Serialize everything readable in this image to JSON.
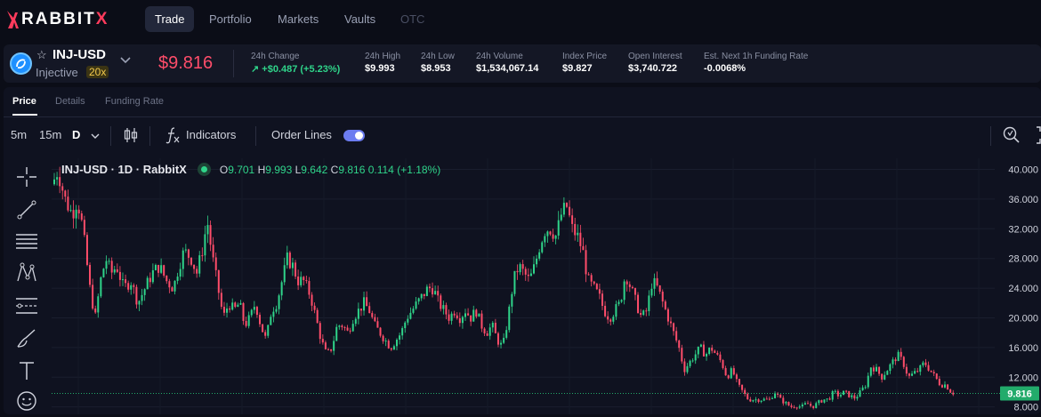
{
  "nav": {
    "logo_main": "RABBIT",
    "logo_x": "X",
    "tabs": [
      "Trade",
      "Portfolio",
      "Markets",
      "Vaults",
      "OTC"
    ]
  },
  "market": {
    "pair": "INJ-USD",
    "name": "Injective",
    "leverage": "20x",
    "price": "$9.816",
    "stats": [
      {
        "label": "24h Change",
        "value": "↗ +$0.487 (+5.23%)",
        "tone": "green"
      },
      {
        "label": "24h High",
        "value": "$9.993",
        "tone": "white"
      },
      {
        "label": "24h Low",
        "value": "$8.953",
        "tone": "white"
      },
      {
        "label": "24h Volume",
        "value": "$1,534,067.14",
        "tone": "white"
      },
      {
        "label": "Index Price",
        "value": "$9.827",
        "tone": "white"
      },
      {
        "label": "Open Interest",
        "value": "$3,740.722",
        "tone": "white"
      },
      {
        "label": "Est. Next 1h Funding Rate",
        "value": "-0.0068%",
        "tone": "white"
      }
    ]
  },
  "panel_tabs": [
    "Price",
    "Details",
    "Funding Rate"
  ],
  "toolbar": {
    "intervals": [
      "5m",
      "15m",
      "D"
    ],
    "indicators": "Indicators",
    "order_lines": "Order Lines",
    "order_lines_on": true
  },
  "legend": {
    "title": "INJ-USD · 1D · RabbitX",
    "o_key": "O",
    "o_val": "9.701",
    "h_key": "H",
    "h_val": "9.993",
    "l_key": "L",
    "l_val": "9.642",
    "c_key": "C",
    "c_val": "9.816",
    "change": "0.114 (+1.18%)"
  },
  "draw_tools": [
    "crosshair-icon",
    "trendline-icon",
    "fib-icon",
    "pattern-icon",
    "prediction-icon",
    "brush-icon",
    "text-icon",
    "emoji-icon"
  ],
  "colors": {
    "up": "#2fd48a",
    "down": "#ff4d6a",
    "price_tag": "#22ab6b"
  },
  "chart_data": {
    "type": "candlestick",
    "title": "INJ-USD · 1D · RabbitX",
    "ylim": [
      7,
      41.5
    ],
    "y_ticks": [
      "40.000",
      "36.000",
      "32.000",
      "28.000",
      "24.000",
      "20.000",
      "16.000",
      "12.000",
      "8.000"
    ],
    "y_tick_values": [
      40,
      36,
      32,
      28,
      24,
      20,
      16,
      12,
      8
    ],
    "last_price": 9.816,
    "last_price_label": "9.816",
    "close_path": [
      [
        0,
        38
      ],
      [
        6,
        40
      ],
      [
        14,
        36
      ],
      [
        22,
        34
      ],
      [
        28,
        36
      ],
      [
        34,
        32
      ],
      [
        42,
        24
      ],
      [
        48,
        20
      ],
      [
        54,
        25
      ],
      [
        60,
        28
      ],
      [
        66,
        26
      ],
      [
        72,
        27
      ],
      [
        80,
        24
      ],
      [
        88,
        25
      ],
      [
        96,
        22
      ],
      [
        104,
        24
      ],
      [
        112,
        26
      ],
      [
        120,
        27
      ],
      [
        128,
        25
      ],
      [
        136,
        24
      ],
      [
        142,
        27
      ],
      [
        148,
        29
      ],
      [
        156,
        28
      ],
      [
        162,
        26
      ],
      [
        168,
        29
      ],
      [
        174,
        33
      ],
      [
        180,
        28
      ],
      [
        186,
        24
      ],
      [
        192,
        20
      ],
      [
        198,
        22
      ],
      [
        204,
        21
      ],
      [
        210,
        22
      ],
      [
        216,
        19
      ],
      [
        222,
        20
      ],
      [
        228,
        22
      ],
      [
        234,
        19
      ],
      [
        240,
        17
      ],
      [
        246,
        21
      ],
      [
        252,
        22
      ],
      [
        258,
        25
      ],
      [
        264,
        28
      ],
      [
        270,
        27
      ],
      [
        276,
        25
      ],
      [
        282,
        25
      ],
      [
        290,
        23
      ],
      [
        296,
        20
      ],
      [
        302,
        17
      ],
      [
        308,
        15
      ],
      [
        314,
        16
      ],
      [
        320,
        19
      ],
      [
        326,
        19
      ],
      [
        332,
        18
      ],
      [
        338,
        20
      ],
      [
        344,
        21
      ],
      [
        350,
        22
      ],
      [
        356,
        21
      ],
      [
        362,
        19
      ],
      [
        368,
        18
      ],
      [
        374,
        17
      ],
      [
        380,
        16
      ],
      [
        386,
        17
      ],
      [
        392,
        18
      ],
      [
        398,
        20
      ],
      [
        404,
        21
      ],
      [
        410,
        22
      ],
      [
        416,
        23
      ],
      [
        422,
        24
      ],
      [
        428,
        24
      ],
      [
        434,
        22
      ],
      [
        440,
        21
      ],
      [
        446,
        20
      ],
      [
        452,
        21
      ],
      [
        458,
        20
      ],
      [
        464,
        21
      ],
      [
        470,
        20
      ],
      [
        476,
        21
      ],
      [
        482,
        19
      ],
      [
        488,
        18
      ],
      [
        494,
        19
      ],
      [
        500,
        17
      ],
      [
        506,
        16
      ],
      [
        512,
        20
      ],
      [
        518,
        25
      ],
      [
        524,
        27
      ],
      [
        530,
        26
      ],
      [
        536,
        25
      ],
      [
        542,
        27
      ],
      [
        548,
        30
      ],
      [
        554,
        32
      ],
      [
        560,
        32
      ],
      [
        566,
        31
      ],
      [
        572,
        34
      ],
      [
        578,
        35
      ],
      [
        584,
        32
      ],
      [
        590,
        31
      ],
      [
        596,
        29
      ],
      [
        602,
        25
      ],
      [
        608,
        24
      ],
      [
        614,
        23
      ],
      [
        620,
        21
      ],
      [
        626,
        20
      ],
      [
        632,
        21
      ],
      [
        638,
        22
      ],
      [
        644,
        26
      ],
      [
        650,
        24
      ],
      [
        656,
        22
      ],
      [
        662,
        20
      ],
      [
        668,
        21
      ],
      [
        674,
        25
      ],
      [
        680,
        24
      ],
      [
        686,
        22
      ],
      [
        692,
        20
      ],
      [
        698,
        18
      ],
      [
        704,
        16
      ],
      [
        710,
        13
      ],
      [
        716,
        14
      ],
      [
        722,
        15
      ],
      [
        728,
        16
      ],
      [
        734,
        15
      ],
      [
        740,
        16
      ],
      [
        746,
        15
      ],
      [
        752,
        14
      ],
      [
        758,
        12
      ],
      [
        764,
        13
      ],
      [
        770,
        11
      ],
      [
        776,
        10
      ],
      [
        782,
        9
      ],
      [
        788,
        9
      ],
      [
        794,
        9
      ],
      [
        800,
        9
      ],
      [
        806,
        9
      ],
      [
        812,
        10
      ],
      [
        818,
        9
      ],
      [
        824,
        8.5
      ],
      [
        830,
        8
      ],
      [
        836,
        8.2
      ],
      [
        842,
        8
      ],
      [
        848,
        8.5
      ],
      [
        854,
        8
      ],
      [
        860,
        8.5
      ],
      [
        866,
        9
      ],
      [
        872,
        9
      ],
      [
        878,
        10
      ],
      [
        884,
        9.5
      ],
      [
        890,
        10
      ],
      [
        896,
        9.5
      ],
      [
        902,
        9.2
      ],
      [
        908,
        10
      ],
      [
        914,
        11
      ],
      [
        920,
        13.5
      ],
      [
        926,
        13
      ],
      [
        932,
        12
      ],
      [
        938,
        13
      ],
      [
        944,
        14
      ],
      [
        950,
        15
      ],
      [
        956,
        14
      ],
      [
        962,
        12
      ],
      [
        968,
        12.5
      ],
      [
        974,
        13
      ],
      [
        980,
        14
      ],
      [
        986,
        13
      ],
      [
        992,
        12
      ],
      [
        998,
        11
      ],
      [
        1004,
        11
      ],
      [
        1010,
        10
      ],
      [
        1014,
        9.816
      ]
    ]
  }
}
